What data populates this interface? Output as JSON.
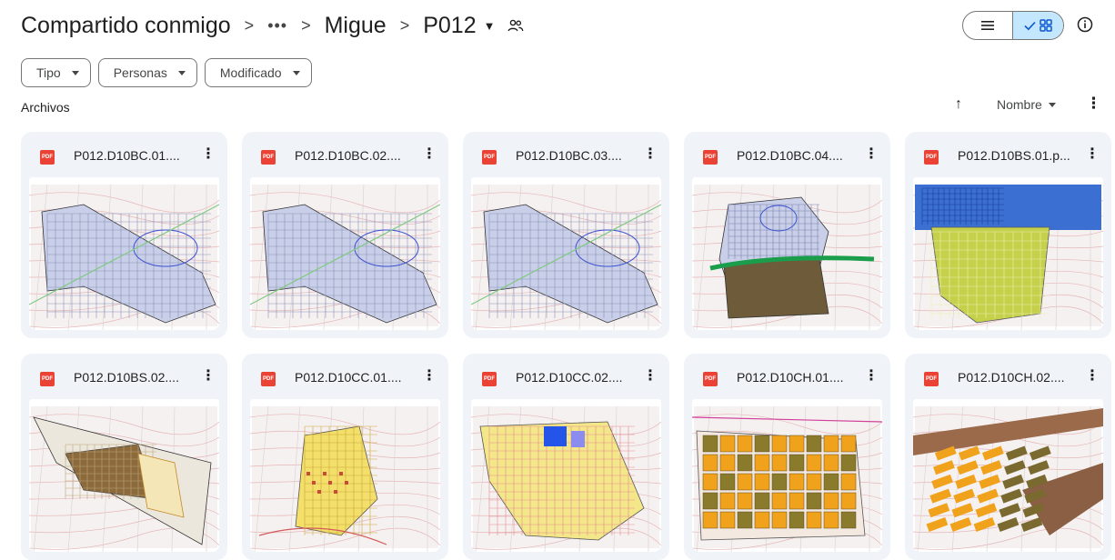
{
  "breadcrumb": {
    "root": "Compartido conmigo",
    "separator": ">",
    "ellipsis": "•••",
    "parent": "Migue",
    "current": "P012"
  },
  "view": {
    "selected": "grid"
  },
  "filters": [
    {
      "label": "Tipo"
    },
    {
      "label": "Personas"
    },
    {
      "label": "Modificado"
    }
  ],
  "section_label": "Archivos",
  "sort": {
    "label": "Nombre"
  },
  "files": [
    {
      "name": "P012.D10BC.01....",
      "badge": "PDF",
      "variant": "blue"
    },
    {
      "name": "P012.D10BC.02....",
      "badge": "PDF",
      "variant": "blue"
    },
    {
      "name": "P012.D10BC.03....",
      "badge": "PDF",
      "variant": "blue"
    },
    {
      "name": "P012.D10BC.04....",
      "badge": "PDF",
      "variant": "green"
    },
    {
      "name": "P012.D10BS.01.p...",
      "badge": "PDF",
      "variant": "yellowblue"
    },
    {
      "name": "P012.D10BS.02....",
      "badge": "PDF",
      "variant": "brown"
    },
    {
      "name": "P012.D10CC.01....",
      "badge": "PDF",
      "variant": "yellow"
    },
    {
      "name": "P012.D10CC.02....",
      "badge": "PDF",
      "variant": "yellowred"
    },
    {
      "name": "P012.D10CH.01....",
      "badge": "PDF",
      "variant": "orange"
    },
    {
      "name": "P012.D10CH.02....",
      "badge": "PDF",
      "variant": "orangebrown"
    }
  ],
  "colors": {
    "accent": "#c2e7ff",
    "card_bg": "#f0f4f9",
    "pdf_red": "#ea4335"
  }
}
